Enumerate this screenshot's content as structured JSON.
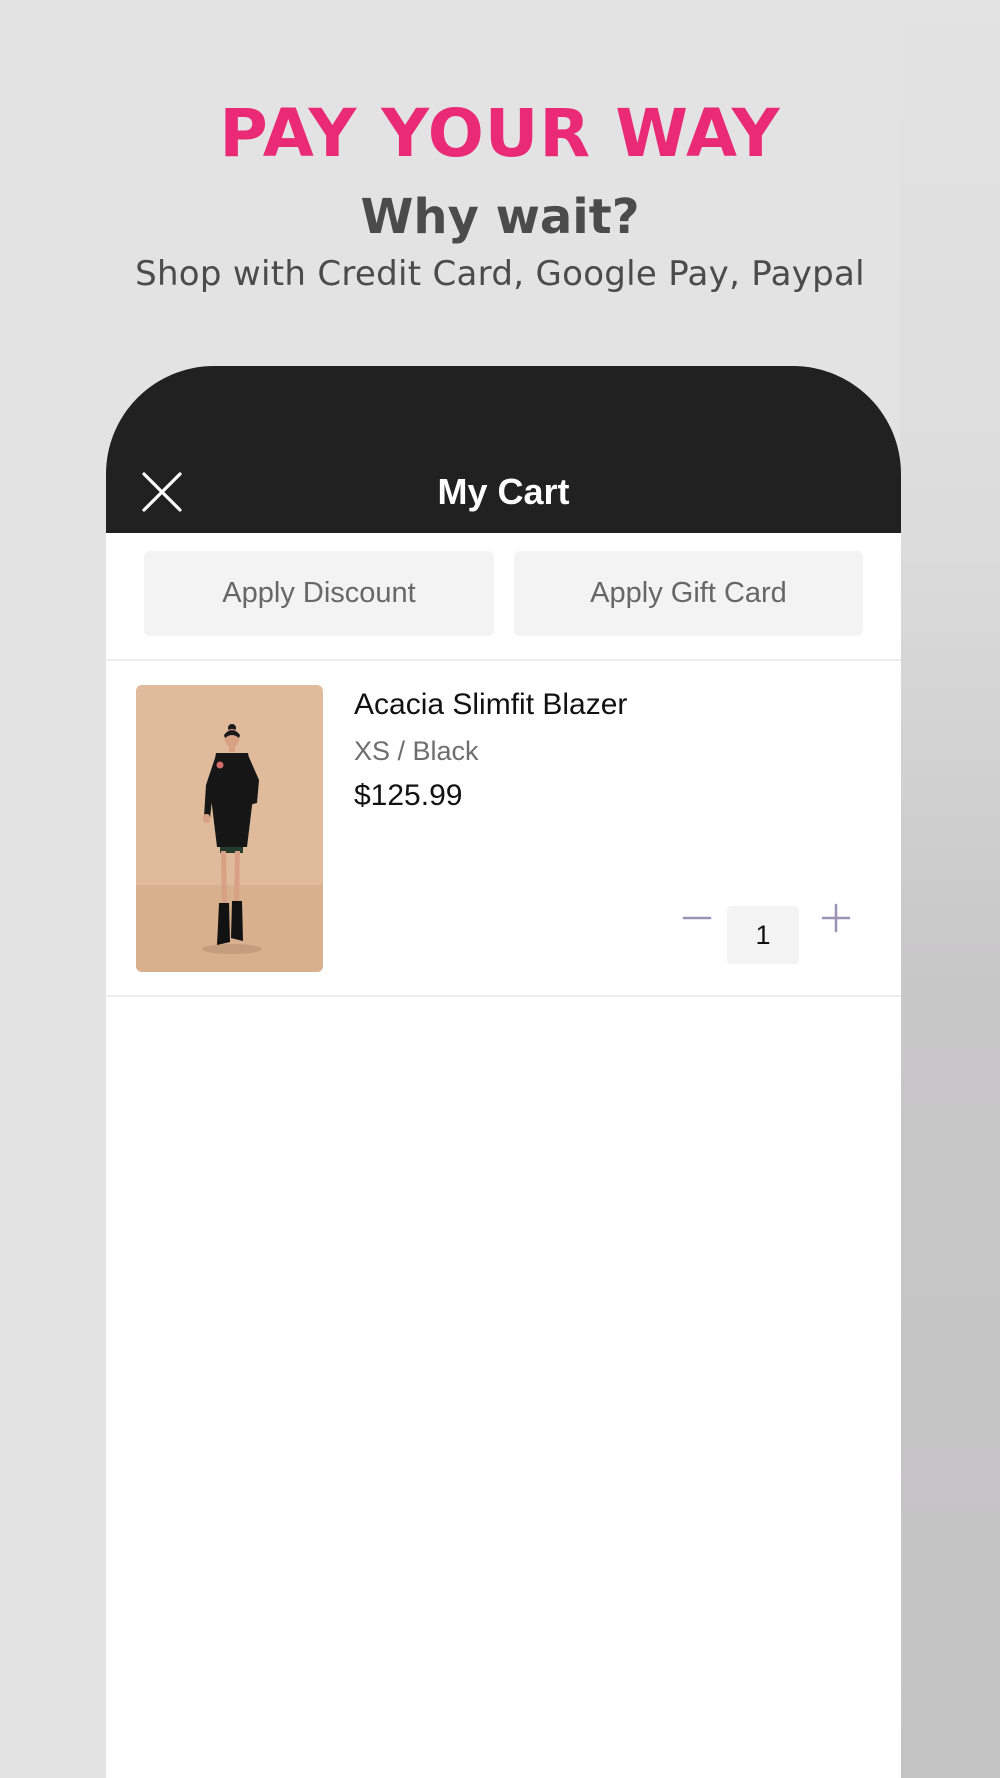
{
  "promo": {
    "title": "PAY YOUR WAY",
    "subtitle": "Why wait?",
    "description": "Shop with Credit Card, Google Pay, Paypal"
  },
  "cart": {
    "title": "My Cart",
    "close_icon": "close-icon",
    "buttons": {
      "apply_discount": "Apply Discount",
      "apply_gift_card": "Apply Gift Card"
    },
    "items": [
      {
        "name": "Acacia Slimfit Blazer",
        "variant": "XS / Black",
        "price": "$125.99",
        "quantity": "1",
        "decrement_icon": "minus-icon",
        "increment_icon": "plus-icon"
      }
    ]
  },
  "colors": {
    "accent_pink": "#ea2a76",
    "subtitle_gray": "#4b4b4b",
    "header_black": "#212121",
    "page_bg": "#e3e3e3",
    "button_bg": "#f3f3f3",
    "button_text": "#676767",
    "divider": "#eeeeee",
    "variant_text": "#6e6e6e",
    "qty_icon": "#9b94b4",
    "text_dark": "#111111",
    "product_bg": "#e0bb9b"
  }
}
